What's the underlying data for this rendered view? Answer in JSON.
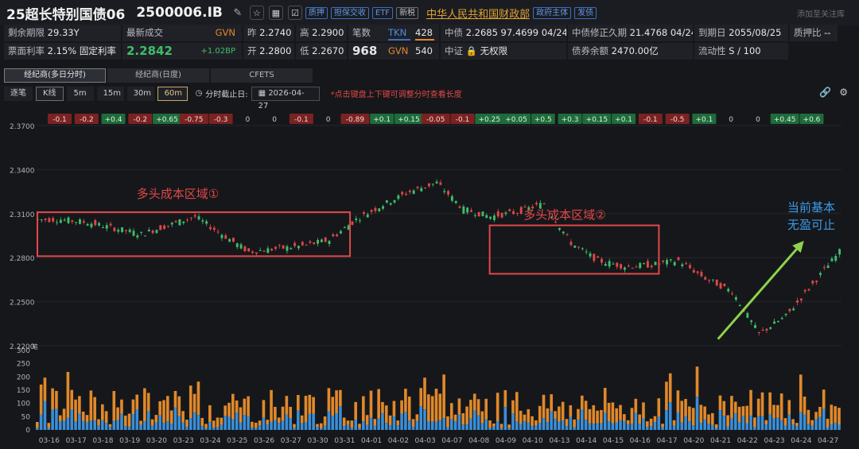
{
  "header": {
    "bond_name": "25超长特别国债06",
    "bond_code": "2500006.IB",
    "tags": [
      "质押",
      "担保交收",
      "ETF",
      "新税"
    ],
    "issuer": "中华人民共和国财政部",
    "issuer_tags": [
      "政府主体",
      "发债"
    ],
    "add_watch": "添加至关注库"
  },
  "info": {
    "remaining_label": "剩余期限",
    "remaining": "29.33Y",
    "coupon_label": "票面利率",
    "coupon": "2.15%",
    "coupon_type": "固定利率",
    "latest_label": "最新成交",
    "latest_price": "2.2842",
    "latest_src": "GVN",
    "latest_change": "+1.02BP",
    "prev_label": "昨",
    "prev": "2.2740",
    "open_label": "开",
    "open": "2.2800",
    "high_label": "高",
    "high": "2.2900",
    "low_label": "低",
    "low": "2.2670",
    "count_label": "笔数",
    "count": "968",
    "tkn_label": "TKN",
    "tkn": "428",
    "gvn_label": "GVN",
    "gvn": "540",
    "cdb_label": "中债",
    "cdb": "2.2685 97.4699 04/24",
    "cdb_dur_label": "中债修正久期",
    "cdb_dur": "21.4768 04/24",
    "csi_label": "中证",
    "csi_icon": "lock-icon",
    "csi": "无权限",
    "balance_label": "债券余额",
    "balance": "2470.00亿",
    "maturity_label": "到期日",
    "maturity": "2055/08/25",
    "liquidity_label": "流动性",
    "liquidity": "S / 100",
    "pledge_label": "质押比",
    "pledge": "--"
  },
  "tabs": [
    "经纪商(多日分时)",
    "经纪商(日度)",
    "CFETS"
  ],
  "toolbar": {
    "tick": "逐笔",
    "kline": "K线",
    "periods": [
      "5m",
      "15m",
      "30m",
      "60m"
    ],
    "cutoff_label": "分时截止日:",
    "date": "2026-04-27",
    "hint": "*点击键盘上下键可调整分时查看长度"
  },
  "colors": {
    "up": "#3dbe6a",
    "down": "#e04848",
    "volume_orange": "#e0892b",
    "volume_blue": "#3a8fd8",
    "annotation": "#e04848",
    "arrow": "#8fd24a"
  },
  "chart_data": {
    "type": "candlestick",
    "y_ticks": [
      "2.3700",
      "2.3400",
      "2.3100",
      "2.2800",
      "2.2500",
      "2.2200"
    ],
    "ylim": [
      2.22,
      2.37
    ],
    "volume_ticks": [
      "300",
      "250",
      "200",
      "150",
      "100",
      "50",
      "0"
    ],
    "volume_unit": "笔",
    "x_labels": [
      "03-16",
      "03-17",
      "03-18",
      "03-19",
      "03-20",
      "03-23",
      "03-24",
      "03-25",
      "03-26",
      "03-27",
      "03-30",
      "03-31",
      "04-01",
      "04-02",
      "04-03",
      "04-07",
      "04-08",
      "04-09",
      "04-10",
      "04-13",
      "04-14",
      "04-15",
      "04-16",
      "04-17",
      "04-20",
      "04-21",
      "04-22",
      "04-23",
      "04-24",
      "04-27"
    ],
    "daily_changes": [
      "-0.1",
      "-0.2",
      "+0.4",
      "-0.2",
      "+0.65",
      "-0.75",
      "-0.3",
      "0",
      "0",
      "-0.1",
      "0",
      "-0.89",
      "+0.1",
      "+0.15",
      "-0.05",
      "-0.1",
      "+0.25",
      "+0.05",
      "+0.5",
      "+0.3",
      "+0.15",
      "+0.1",
      "-0.1",
      "-0.5",
      "+0.1",
      "0",
      "0",
      "+0.45",
      "+0.6"
    ],
    "daily_closes": [
      2.306,
      2.304,
      2.3,
      2.296,
      2.302,
      2.308,
      2.296,
      2.284,
      2.286,
      2.288,
      2.292,
      2.306,
      2.316,
      2.325,
      2.331,
      2.313,
      2.308,
      2.311,
      2.317,
      2.29,
      2.278,
      2.274,
      2.275,
      2.278,
      2.266,
      2.257,
      2.228,
      2.24,
      2.262,
      2.284
    ],
    "annotations": [
      {
        "text": "多头成本区域①",
        "y_range": [
          2.281,
          2.311
        ]
      },
      {
        "text": "多头成本区域②",
        "y_range": [
          2.269,
          2.302
        ]
      },
      {
        "text": "当前基本",
        "text2": "无盈可止"
      }
    ]
  }
}
